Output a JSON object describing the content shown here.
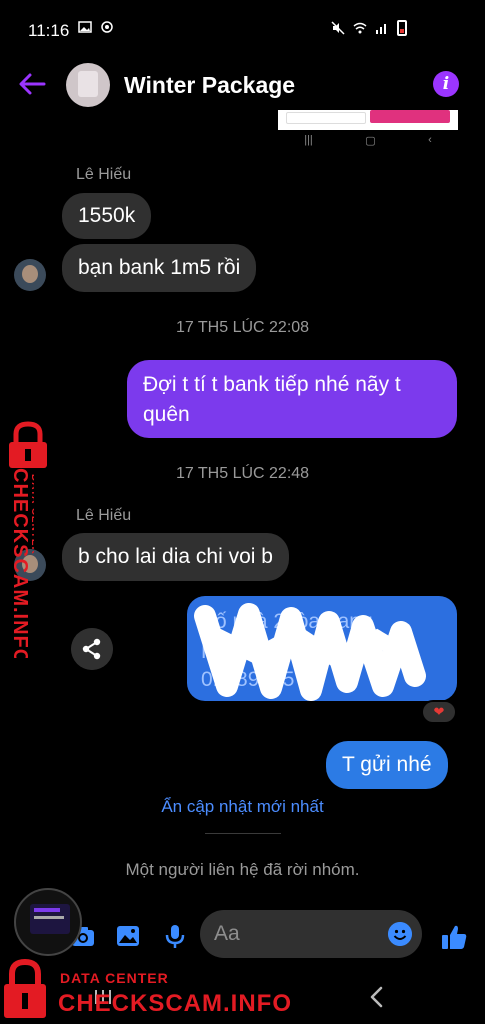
{
  "status_bar": {
    "time": "11:16"
  },
  "header": {
    "title": "Winter Package"
  },
  "messages": {
    "sender_1": "Lê Hiếu",
    "msg_1": "1550k",
    "msg_2": "bạn bank 1m5 rồi",
    "timestamp_1": "17 TH5 LÚC 22:08",
    "msg_3_line1": "Đợi t tí t bank tiếp nhé nãy t",
    "msg_3_line2": "quên",
    "timestamp_2": "17 TH5 LÚC 22:48",
    "sender_2": "Lê Hiếu",
    "msg_4": "b cho lai dia chi voi b",
    "img_msg_line1": "Số nhà 2 tòa hang",
    "img_msg_line2": "Hà Nội... kiện",
    "img_msg_line3": "0... 89... 5",
    "reaction": "❤",
    "msg_5": "T gửi nhé"
  },
  "see_update": "Ẩn cập nhật mới nhất",
  "left_notice": "Một người liên hệ đã rời nhóm.",
  "composer": {
    "placeholder": "Aa"
  },
  "watermark": {
    "small": "DATA CENTER",
    "big": "CHECKSCAM.INFO"
  },
  "colors": {
    "accent": "#9b35ff",
    "outgoing": "#7c3aed",
    "incoming": "#303030",
    "link": "#4c8dff",
    "watermark": "#e31b23"
  }
}
